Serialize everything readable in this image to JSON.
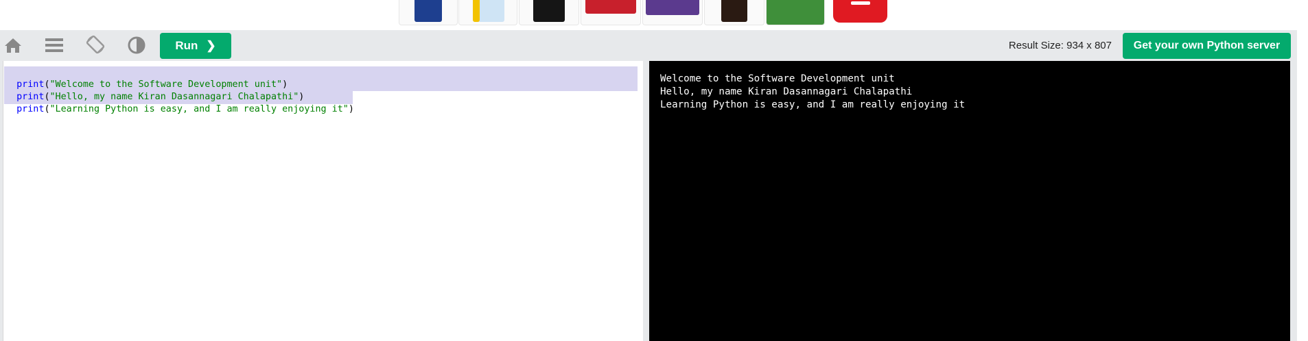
{
  "toolbar": {
    "run_label": "Run",
    "run_chevron": "❯",
    "result_size": "Result Size: 934 x 807",
    "server_button": "Get your own Python server",
    "icons": [
      "home-icon",
      "menu-icon",
      "rotate-icon",
      "contrast-icon"
    ]
  },
  "editor": {
    "lines": [
      {
        "fn": "print",
        "open": "(",
        "str": "\"Welcome to the Software Development unit\"",
        "close": ")"
      },
      {
        "fn": "print",
        "open": "(",
        "str": "\"Hello, my name Kiran Dasannagari Chalapathi\"",
        "close": ")"
      },
      {
        "fn": "print",
        "open": "(",
        "str": "\"Learning Python is easy, and I am really enjoying it\"",
        "close": ")"
      }
    ]
  },
  "output": {
    "lines": [
      "Welcome to the Software Development unit",
      "Hello, my name Kiran Dasannagari Chalapathi",
      "Learning Python is easy, and I am really enjoying it"
    ]
  },
  "colors": {
    "accent": "#04aa6d",
    "toolbar_bg": "#e7e9eb",
    "selection": "#d7d4f0",
    "keyword": "#0000ff",
    "string": "#008000"
  }
}
